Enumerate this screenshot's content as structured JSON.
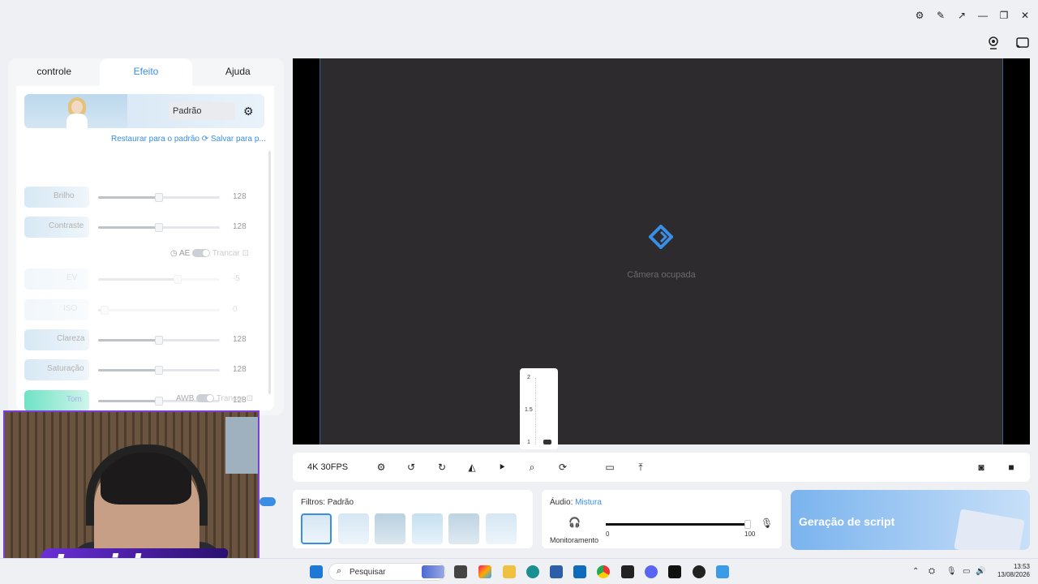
{
  "window": {
    "controls": [
      "⚙",
      "✎",
      "↗",
      "—",
      "❐",
      "✕"
    ]
  },
  "left_panel": {
    "tabs": [
      {
        "label": "controle"
      },
      {
        "label": "Efeito"
      },
      {
        "label": "Ajuda"
      }
    ],
    "preset": {
      "selected": "Padrão"
    },
    "links": {
      "restore": "Restaurar para o padrão",
      "save": "Salvar para p..."
    },
    "controls": [
      {
        "label": "Brilho",
        "value": "128",
        "level": 0.5
      },
      {
        "label": "Contraste",
        "value": "128",
        "level": 0.5
      },
      {
        "label": "EV",
        "value": "-5",
        "level": 0.65
      },
      {
        "label": "ISO",
        "value": "0",
        "level": 0.05
      },
      {
        "label": "Clareza",
        "value": "128",
        "level": 0.5
      },
      {
        "label": "Saturação",
        "value": "128",
        "level": 0.5
      },
      {
        "label": "Tom",
        "value": "128",
        "level": 0.5
      }
    ],
    "ae": {
      "label": "AE",
      "lock": "Trancar"
    },
    "awb": {
      "label": "AWB",
      "lock": "Trancar"
    }
  },
  "overlay": {
    "brand": "Insider"
  },
  "preview": {
    "status": "Câmera ocupada"
  },
  "zoom_popup": {
    "ticks": [
      "2",
      "1.5",
      "1"
    ],
    "level": 0
  },
  "toolbar": {
    "resolution": "4K 30FPS"
  },
  "filters": {
    "label": "Filtros:",
    "value": "Padrão"
  },
  "audio": {
    "label": "Áudio:",
    "value": "Mistura",
    "monitor": "Monitoramento",
    "min": "0",
    "max": "100",
    "level": 1.0
  },
  "script_banner": {
    "label": "Geração de script"
  },
  "taskbar": {
    "search": "Pesquisar",
    "time": "13:53",
    "date": "13/08/2026"
  },
  "colors": {
    "accent": "#3a8ee6",
    "overlay_border": "#7c3fd9"
  }
}
